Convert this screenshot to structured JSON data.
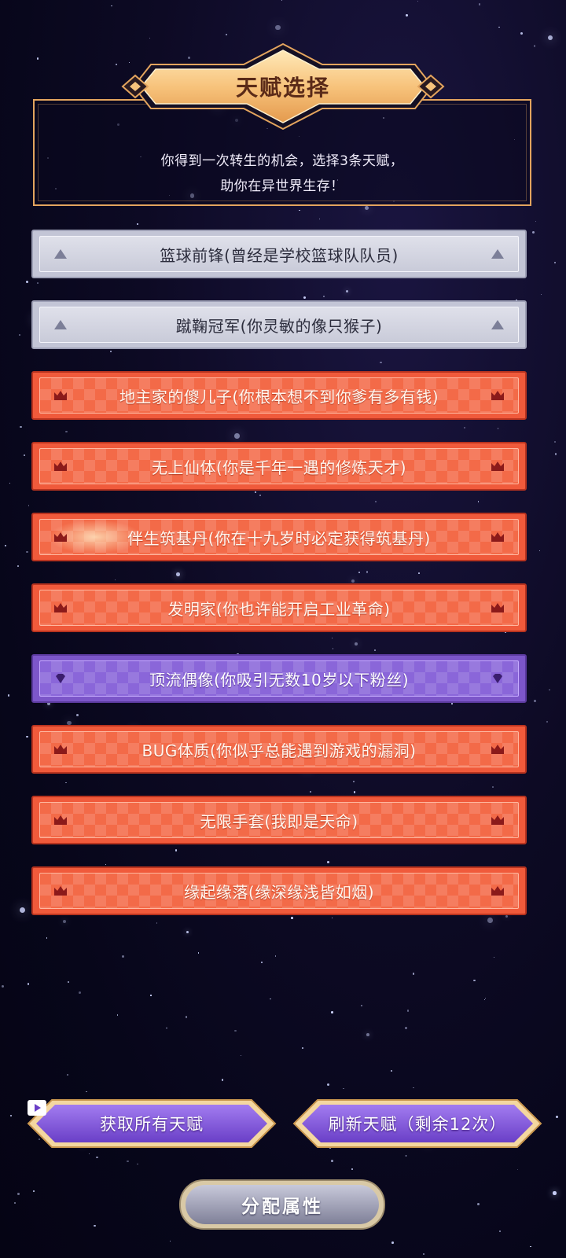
{
  "header": {
    "title": "天赋选择",
    "subtitle_line1": "你得到一次转生的机会，选择3条天赋，",
    "subtitle_line2": "助你在异世界生存！"
  },
  "talents": [
    {
      "label": "篮球前锋(曾经是学校篮球队队员)",
      "tier": "common",
      "icon": "triangle-icon"
    },
    {
      "label": "蹴鞠冠军(你灵敏的像只猴子)",
      "tier": "common",
      "icon": "triangle-icon"
    },
    {
      "label": "地主家的傻儿子(你根本想不到你爹有多有钱)",
      "tier": "rare",
      "icon": "crown-icon"
    },
    {
      "label": "无上仙体(你是千年一遇的修炼天才)",
      "tier": "rare",
      "icon": "crown-icon"
    },
    {
      "label": "伴生筑基丹(你在十九岁时必定获得筑基丹)",
      "tier": "rare",
      "icon": "crown-icon"
    },
    {
      "label": "发明家(你也许能开启工业革命)",
      "tier": "rare",
      "icon": "crown-icon"
    },
    {
      "label": "顶流偶像(你吸引无数10岁以下粉丝)",
      "tier": "epic",
      "icon": "diamond-icon"
    },
    {
      "label": "BUG体质(你似乎总能遇到游戏的漏洞)",
      "tier": "rare",
      "icon": "crown-icon"
    },
    {
      "label": "无限手套(我即是天命)",
      "tier": "rare",
      "icon": "crown-icon"
    },
    {
      "label": "缘起缘落(缘深缘浅皆如烟)",
      "tier": "rare",
      "icon": "crown-icon"
    }
  ],
  "buttons": {
    "get_all": "获取所有天赋",
    "refresh": "刷新天赋（剩余12次）",
    "assign": "分配属性"
  },
  "colors": {
    "common": "#c9cbd9",
    "rare": "#f36a48",
    "epic": "#8a66d9",
    "gold": "#e3a45e",
    "button_purple": "#7a4fd6"
  }
}
